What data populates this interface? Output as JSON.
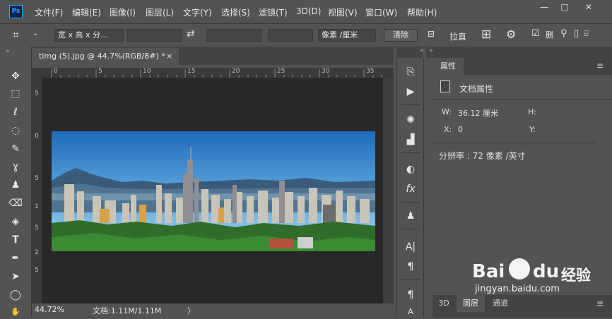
{
  "app": {
    "logo_text": "Ps"
  },
  "menubar": {
    "items": [
      "文件(F)",
      "编辑(E)",
      "图像(I)",
      "图层(L)",
      "文字(Y)",
      "选择(S)",
      "滤镜(T)",
      "3D(D)",
      "视图(V)",
      "窗口(W)",
      "帮助(H)"
    ]
  },
  "window_controls": {
    "minimize": "—",
    "maximize": "□",
    "close": "✕"
  },
  "options_bar": {
    "ratio_select": "宽 x 高 x 分...",
    "swap_icon": "⇄",
    "unit_select": "像素 /厘米",
    "clear_button": "清除",
    "straighten_label": "拉直"
  },
  "document": {
    "tab_title": "timg (5).jpg @ 44.7%(RGB/8#) *",
    "tab_close": "×",
    "ruler_h_ticks": [
      "0",
      "5",
      "10",
      "15",
      "20",
      "25",
      "30",
      "35"
    ],
    "ruler_v_ticks": [
      "5",
      "0",
      "5",
      "1",
      "5",
      "2",
      "5"
    ]
  },
  "status": {
    "zoom": "44.72%",
    "doc_info": "文档:1.11M/1.11M",
    "arrow": "〉"
  },
  "properties": {
    "tab": "属性",
    "section_title": "文档属性",
    "w_label": "W:",
    "w_value": "36.12 厘米",
    "h_label": "H:",
    "x_label": "X:",
    "x_value": "0",
    "y_label": "Y:",
    "resolution": "分辨率 : 72 像素 /英寸"
  },
  "bottom_tabs": [
    "3D",
    "图层",
    "通道"
  ],
  "watermark": {
    "brand": "Bai",
    "brand2": "du",
    "cn": "经验",
    "url": "jingyan.baidu.com"
  }
}
